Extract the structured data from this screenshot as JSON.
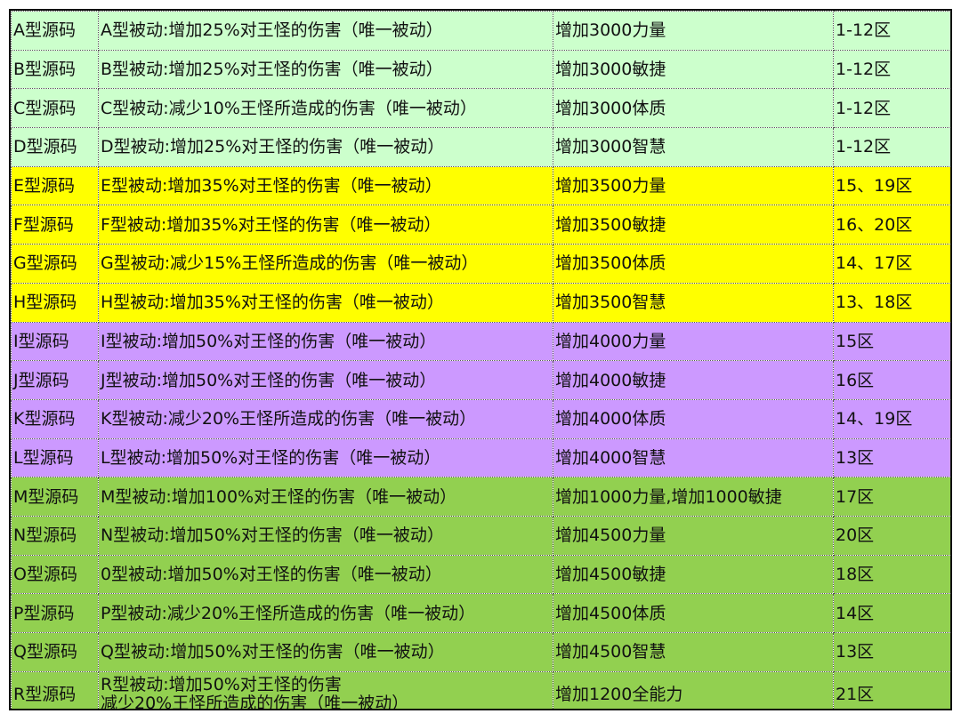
{
  "colors": {
    "tier1": "#ccffcc",
    "tier2": "#ffff00",
    "tier3": "#cc99ff",
    "tier4": "#92d050",
    "grid_line": "#555555",
    "border": "#111111"
  },
  "rows": [
    {
      "tier": "tier1",
      "name": "A型源码",
      "effect": "A型被动:增加25%对王怪的伤害（唯一被动）",
      "bonus": "增加3000力量",
      "zone": "1-12区"
    },
    {
      "tier": "tier1",
      "name": "B型源码",
      "effect": "B型被动:增加25%对王怪的伤害（唯一被动）",
      "bonus": "增加3000敏捷",
      "zone": "1-12区"
    },
    {
      "tier": "tier1",
      "name": "C型源码",
      "effect": "C型被动:减少10%王怪所造成的伤害（唯一被动）",
      "bonus": "增加3000体质",
      "zone": "1-12区"
    },
    {
      "tier": "tier1",
      "name": "D型源码",
      "effect": "D型被动:增加25%对王怪的伤害（唯一被动）",
      "bonus": "增加3000智慧",
      "zone": "1-12区"
    },
    {
      "tier": "tier2",
      "name": "E型源码",
      "effect": "E型被动:增加35%对王怪的伤害（唯一被动）",
      "bonus": "增加3500力量",
      "zone": "15、19区"
    },
    {
      "tier": "tier2",
      "name": "F型源码",
      "effect": "F型被动:增加35%对王怪的伤害（唯一被动）",
      "bonus": "增加3500敏捷",
      "zone": "16、20区"
    },
    {
      "tier": "tier2",
      "name": "G型源码",
      "effect": "G型被动:减少15%王怪所造成的伤害（唯一被动）",
      "bonus": "增加3500体质",
      "zone": "14、17区"
    },
    {
      "tier": "tier2",
      "name": "H型源码",
      "effect": "H型被动:增加35%对王怪的伤害（唯一被动）",
      "bonus": "增加3500智慧",
      "zone": "13、18区"
    },
    {
      "tier": "tier3",
      "name": "I型源码",
      "effect": "I型被动:增加50%对王怪的伤害（唯一被动）",
      "bonus": "增加4000力量",
      "zone": "15区"
    },
    {
      "tier": "tier3",
      "name": "J型源码",
      "effect": "J型被动:增加50%对王怪的伤害（唯一被动）",
      "bonus": "增加4000敏捷",
      "zone": "16区"
    },
    {
      "tier": "tier3",
      "name": "K型源码",
      "effect": "K型被动:减少20%王怪所造成的伤害（唯一被动）",
      "bonus": "增加4000体质",
      "zone": "14、19区"
    },
    {
      "tier": "tier3",
      "name": "L型源码",
      "effect": "L型被动:增加50%对王怪的伤害（唯一被动）",
      "bonus": "增加4000智慧",
      "zone": "13区"
    },
    {
      "tier": "tier4",
      "name": "M型源码",
      "effect": "M型被动:增加100%对王怪的伤害（唯一被动）",
      "bonus": "增加1000力量,增加1000敏捷",
      "zone": "17区"
    },
    {
      "tier": "tier4",
      "name": "N型源码",
      "effect": "N型被动:增加50%对王怪的伤害（唯一被动）",
      "bonus": "增加4500力量",
      "zone": "20区"
    },
    {
      "tier": "tier4",
      "name": "O型源码",
      "effect": "0型被动:增加50%对王怪的伤害（唯一被动）",
      "bonus": "增加4500敏捷",
      "zone": "18区"
    },
    {
      "tier": "tier4",
      "name": "P型源码",
      "effect": "P型被动:减少20%王怪所造成的伤害（唯一被动）",
      "bonus": "增加4500体质",
      "zone": "14区"
    },
    {
      "tier": "tier4",
      "name": "Q型源码",
      "effect": "Q型被动:增加50%对王怪的伤害（唯一被动）",
      "bonus": "增加4500智慧",
      "zone": "13区"
    }
  ],
  "last_row": {
    "tier": "tier4",
    "name": "R型源码",
    "effect_line1": "R型被动:增加50%对王怪的伤害",
    "effect_line2": "减少20%王怪所造成的伤害（唯一被动）",
    "bonus": "增加1200全能力",
    "zone": "21区"
  }
}
